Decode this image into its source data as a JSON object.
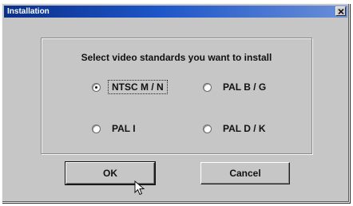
{
  "window": {
    "title": "Installation",
    "close_glyph": "×"
  },
  "dialog": {
    "prompt": "Select video standards you want to install",
    "options": [
      {
        "label": "NTSC M / N",
        "checked": true
      },
      {
        "label": "PAL B / G",
        "checked": false
      },
      {
        "label": "PAL I",
        "checked": false
      },
      {
        "label": "PAL D / K",
        "checked": false
      }
    ],
    "ok_label": "OK",
    "cancel_label": "Cancel"
  },
  "colors": {
    "titlebar_start": "#0a2f8a",
    "titlebar_end": "#6a8fd8",
    "face": "#c6c6c6"
  },
  "icons": {
    "close": "close-icon",
    "cursor": "mouse-pointer-icon"
  }
}
